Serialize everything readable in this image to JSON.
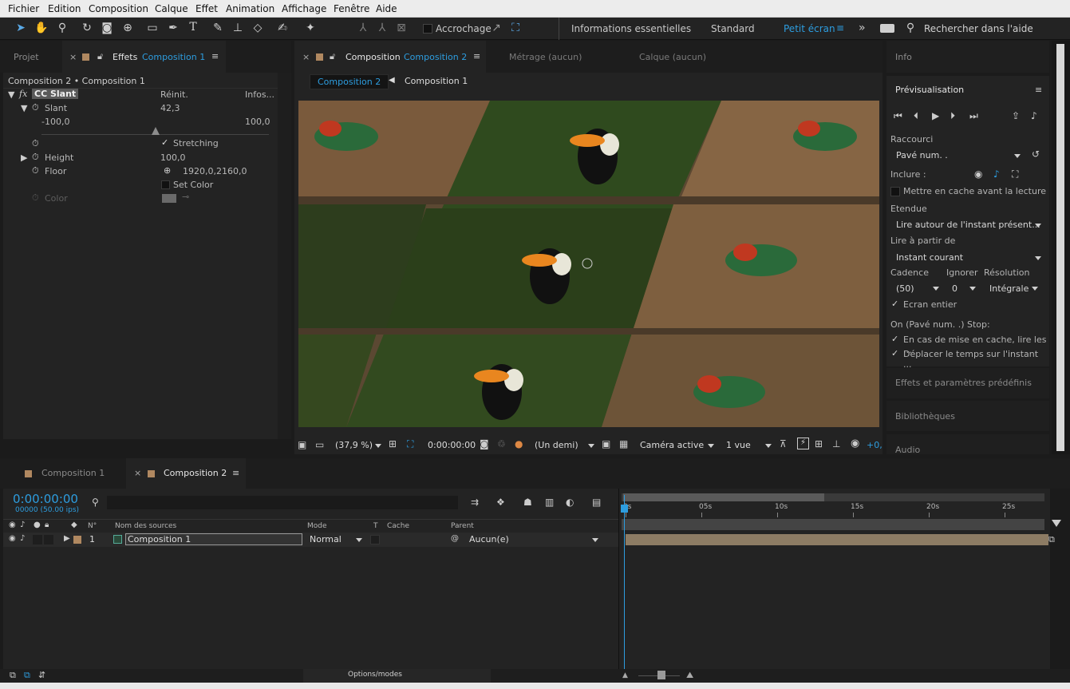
{
  "menu": [
    "Fichier",
    "Edition",
    "Composition",
    "Calque",
    "Effet",
    "Animation",
    "Affichage",
    "Fenêtre",
    "Aide"
  ],
  "toolbar": {
    "snapping": "Accrochage",
    "workspaces": [
      "Informations essentielles",
      "Standard",
      "Petit écran"
    ],
    "more": "»",
    "search_placeholder": "Rechercher dans l'aide"
  },
  "left": {
    "tabs": {
      "project": "Projet",
      "effects_prefix": "Effets",
      "effects_comp": "Composition 1"
    },
    "breadcrumb": "Composition 2 • Composition 1",
    "effect_name": "CC Slant",
    "reset": "Réinit.",
    "infos": "Infos...",
    "slant_label": "Slant",
    "slant_value": "42,3",
    "slant_min": "-100,0",
    "slant_max": "100,0",
    "slant_level": 0.5,
    "stretching": "Stretching",
    "height_label": "Height",
    "height_value": "100,0",
    "floor_label": "Floor",
    "floor_value": "1920,0,2160,0",
    "set_color": "Set Color",
    "color_label": "Color"
  },
  "viewer": {
    "tab_prefix": "Composition",
    "tab_comp": "Composition 2",
    "footage_tab": "Métrage  (aucun)",
    "layer_tab": "Calque  (aucun)",
    "crumb_active": "Composition 2",
    "crumb_parent": "Composition 1",
    "zoom": "(37,9 %)",
    "timecode": "0:00:00:00",
    "resolution": "(Un demi)",
    "camera": "Caméra active",
    "views": "1 vue",
    "exposure": "+0,"
  },
  "right": {
    "info": "Info",
    "preview_title": "Prévisualisation",
    "shortcut_label": "Raccourci",
    "shortcut_value": "Pavé num. .",
    "include_label": "Inclure :",
    "cache_before": "Mettre en cache avant la lecture",
    "range_label": "Etendue",
    "range_value": "Lire autour de l'instant présent...",
    "play_from_label": "Lire à partir de",
    "play_from_value": "Instant courant",
    "frame_rate_label": "Cadence",
    "skip_label": "Ignorer",
    "resolution_label": "Résolution",
    "frame_rate_value": "(50)",
    "skip_value": "0",
    "resolution_value": "Intégrale",
    "fullscreen": "Ecran entier",
    "stop_label": "On (Pavé num. .) Stop:",
    "if_cached": "En cas de mise en cache, lire les ...",
    "move_time": "Déplacer le temps sur l'instant ...",
    "effects_presets": "Effets et paramètres prédéfinis",
    "libraries": "Bibliothèques",
    "audio": "Audio"
  },
  "timeline": {
    "tabs": [
      "Composition 1",
      "Composition 2"
    ],
    "timecode": "0:00:00:00",
    "fps": "00000 (50.00 ips)",
    "headers": {
      "num": "N°",
      "source": "Nom des sources",
      "mode": "Mode",
      "t": "T",
      "cache": "Cache",
      "parent": "Parent"
    },
    "layer": {
      "num": "1",
      "name": "Composition 1",
      "mode": "Normal",
      "parent": "Aucun(e)"
    },
    "ruler": [
      "0s",
      "05s",
      "10s",
      "15s",
      "20s",
      "25s"
    ],
    "footer": "Options/modes"
  },
  "colors": {
    "accent": "#2d9ddf",
    "label_tan": "#b08860",
    "track": "#8d7c64"
  }
}
